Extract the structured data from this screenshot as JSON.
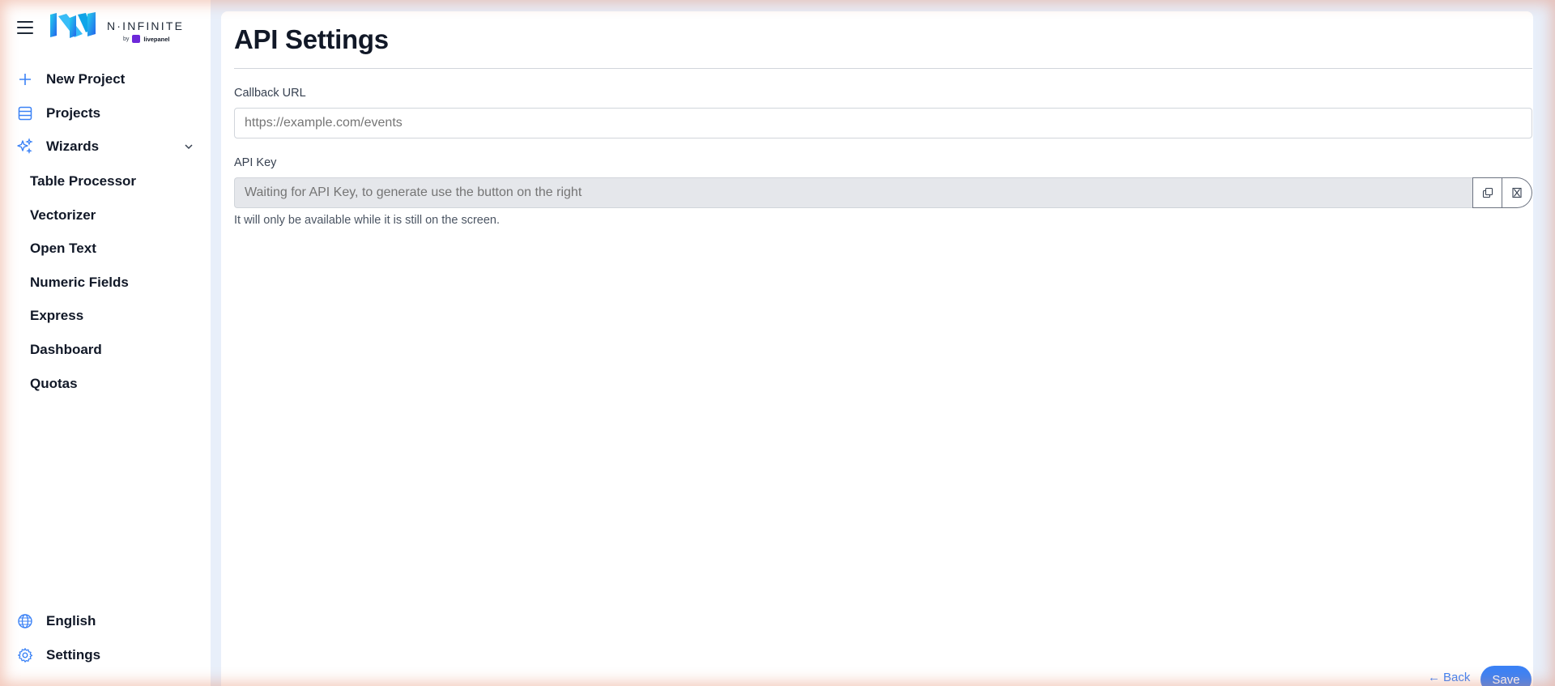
{
  "brand": {
    "name": "N·INFINITE",
    "by_text": "by",
    "by_brand": "livepanel",
    "accent": "#3b82f6"
  },
  "sidebar": {
    "menu_icon": "hamburger-icon",
    "items": [
      {
        "label": "New Project",
        "icon": "plus-icon"
      },
      {
        "label": "Projects",
        "icon": "list-icon"
      },
      {
        "label": "Wizards",
        "icon": "sparkles-icon",
        "expanded": true
      }
    ],
    "wizards": [
      {
        "label": "Table Processor"
      },
      {
        "label": "Vectorizer"
      },
      {
        "label": "Open Text"
      },
      {
        "label": "Numeric Fields"
      },
      {
        "label": "Express"
      },
      {
        "label": "Dashboard"
      },
      {
        "label": "Quotas"
      }
    ],
    "bottom": [
      {
        "label": "English",
        "icon": "globe-icon"
      },
      {
        "label": "Settings",
        "icon": "gear-icon"
      }
    ]
  },
  "main": {
    "title": "API Settings",
    "callback": {
      "label": "Callback URL",
      "placeholder": "https://example.com/events",
      "value": ""
    },
    "api_key": {
      "label": "API Key",
      "placeholder": "Waiting for API Key, to generate use the button on the right",
      "value": "",
      "copy_icon": "copy-icon",
      "generate_icon": "hourglass-icon"
    },
    "hint": "It will only be available while it is still on the screen.",
    "back_label": "Back",
    "save_label": "Save"
  }
}
